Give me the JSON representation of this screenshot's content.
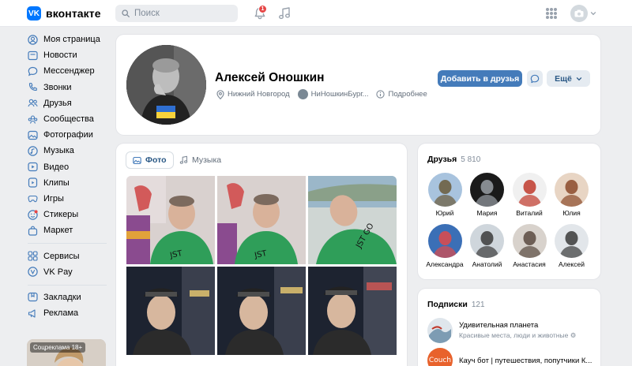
{
  "header": {
    "logo_mark": "VK",
    "logo_text": "вконтакте",
    "search_placeholder": "Поиск",
    "notifications_count": "1"
  },
  "sidebar": {
    "items": [
      {
        "label": "Моя страница",
        "icon": "user-circle-icon"
      },
      {
        "label": "Новости",
        "icon": "newspaper-icon"
      },
      {
        "label": "Мессенджер",
        "icon": "chat-bubble-icon"
      },
      {
        "label": "Звонки",
        "icon": "phone-icon"
      },
      {
        "label": "Друзья",
        "icon": "friends-icon"
      },
      {
        "label": "Сообщества",
        "icon": "communities-icon"
      },
      {
        "label": "Фотографии",
        "icon": "photo-icon"
      },
      {
        "label": "Музыка",
        "icon": "music-icon"
      },
      {
        "label": "Видео",
        "icon": "video-icon"
      },
      {
        "label": "Клипы",
        "icon": "clips-icon"
      },
      {
        "label": "Игры",
        "icon": "gamepad-icon"
      },
      {
        "label": "Стикеры",
        "icon": "sticker-icon"
      },
      {
        "label": "Маркет",
        "icon": "market-bag-icon"
      }
    ],
    "items2": [
      {
        "label": "Сервисы",
        "icon": "services-icon"
      },
      {
        "label": "VK Pay",
        "icon": "vkpay-icon"
      }
    ],
    "items3": [
      {
        "label": "Закладки",
        "icon": "bookmark-icon"
      },
      {
        "label": "Реклама",
        "icon": "megaphone-icon"
      }
    ],
    "ad_badge": "Соцреклама 18+"
  },
  "profile": {
    "name": "Алексей Оношкин",
    "city": "Нижний Новгород",
    "community": "НиНошкинБург...",
    "more_info": "Подробнее",
    "add_friend": "Добавить в друзья",
    "more": "Ещё"
  },
  "media": {
    "tab_photo": "Фото",
    "tab_music": "Музыка"
  },
  "friends": {
    "title": "Друзья",
    "count": "5 810",
    "list": [
      {
        "name": "Юрий"
      },
      {
        "name": "Мария"
      },
      {
        "name": "Виталий"
      },
      {
        "name": "Юлия"
      },
      {
        "name": "Александра"
      },
      {
        "name": "Анатолий"
      },
      {
        "name": "Анастасия"
      },
      {
        "name": "Алексей"
      }
    ]
  },
  "subscriptions": {
    "title": "Подписки",
    "count": "121",
    "list": [
      {
        "title": "Удивительная планета",
        "desc": "Красивые места, люди и животные",
        "avatar_text": ""
      },
      {
        "title": "Кауч бот | путешествия, попутчики К...",
        "desc": "",
        "avatar_text": "Couch"
      }
    ]
  },
  "colors": {
    "accent": "#447bba",
    "vk_blue": "#0077ff",
    "link": "#2a5885",
    "background": "#edeef0"
  }
}
